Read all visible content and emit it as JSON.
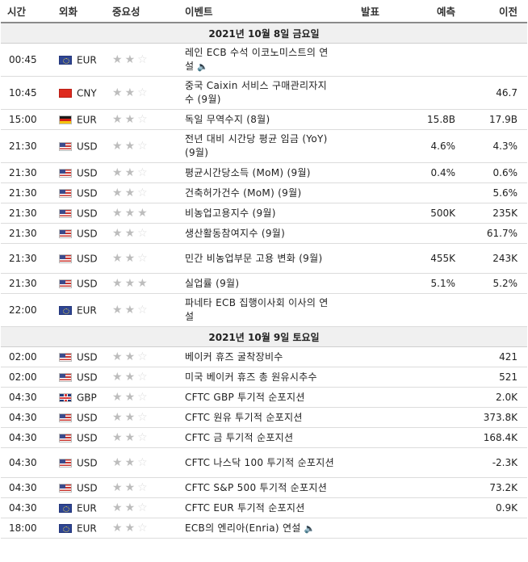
{
  "header": {
    "time": "시간",
    "currency": "외화",
    "importance": "중요성",
    "event": "이벤트",
    "actual": "발표",
    "forecast": "예측",
    "previous": "이전"
  },
  "days": [
    {
      "date": "2021년 10월 8일 금요일",
      "rows": [
        {
          "time": "00:45",
          "flag": "f-eu",
          "currency": "EUR",
          "stars": 2,
          "event": "레인 ECB 수석 이코노미스트의 연설",
          "speaker": true,
          "actual": "",
          "forecast": "",
          "previous": ""
        },
        {
          "time": "10:45",
          "flag": "f-cn",
          "currency": "CNY",
          "stars": 2,
          "event": "중국 Caixin 서비스 구매관리자지수 (9월)",
          "speaker": false,
          "actual": "",
          "forecast": "",
          "previous": "46.7"
        },
        {
          "time": "15:00",
          "flag": "f-de",
          "currency": "EUR",
          "stars": 2,
          "event": "독일 무역수지 (8월)",
          "speaker": false,
          "actual": "",
          "forecast": "15.8B",
          "previous": "17.9B"
        },
        {
          "time": "21:30",
          "flag": "f-us",
          "currency": "USD",
          "stars": 2,
          "event": "전년 대비 시간당 평균 임금 (YoY) (9월)",
          "speaker": false,
          "actual": "",
          "forecast": "4.6%",
          "previous": "4.3%"
        },
        {
          "time": "21:30",
          "flag": "f-us",
          "currency": "USD",
          "stars": 2,
          "event": "평균시간당소득 (MoM) (9월)",
          "speaker": false,
          "actual": "",
          "forecast": "0.4%",
          "previous": "0.6%"
        },
        {
          "time": "21:30",
          "flag": "f-us",
          "currency": "USD",
          "stars": 2,
          "event": "건축허가건수 (MoM) (9월)",
          "speaker": false,
          "actual": "",
          "forecast": "",
          "previous": "5.6%"
        },
        {
          "time": "21:30",
          "flag": "f-us",
          "currency": "USD",
          "stars": 3,
          "event": "비농업고용지수 (9월)",
          "speaker": false,
          "actual": "",
          "forecast": "500K",
          "previous": "235K"
        },
        {
          "time": "21:30",
          "flag": "f-us",
          "currency": "USD",
          "stars": 2,
          "event": "생산활동참여지수 (9월)",
          "speaker": false,
          "actual": "",
          "forecast": "",
          "previous": "61.7%"
        },
        {
          "time": "21:30",
          "flag": "f-us",
          "currency": "USD",
          "stars": 2,
          "event": "민간 비농업부문 고용 변화 (9월)",
          "speaker": false,
          "actual": "",
          "forecast": "455K",
          "previous": "243K"
        },
        {
          "time": "21:30",
          "flag": "f-us",
          "currency": "USD",
          "stars": 3,
          "event": "실업률 (9월)",
          "speaker": false,
          "actual": "",
          "forecast": "5.1%",
          "previous": "5.2%"
        },
        {
          "time": "22:00",
          "flag": "f-eu",
          "currency": "EUR",
          "stars": 2,
          "event": "파네타 ECB 집행이사회 이사의 연설",
          "speaker": false,
          "actual": "",
          "forecast": "",
          "previous": ""
        }
      ]
    },
    {
      "date": "2021년 10월 9일 토요일",
      "rows": [
        {
          "time": "02:00",
          "flag": "f-us",
          "currency": "USD",
          "stars": 2,
          "event": "베이커 휴즈 굴착장비수",
          "speaker": false,
          "actual": "",
          "forecast": "",
          "previous": "421"
        },
        {
          "time": "02:00",
          "flag": "f-us",
          "currency": "USD",
          "stars": 2,
          "event": "미국 베이커 휴즈 총 원유시추수",
          "speaker": false,
          "actual": "",
          "forecast": "",
          "previous": "521"
        },
        {
          "time": "04:30",
          "flag": "f-gb",
          "currency": "GBP",
          "stars": 2,
          "event": "CFTC GBP 투기적 순포지션",
          "speaker": false,
          "actual": "",
          "forecast": "",
          "previous": "2.0K"
        },
        {
          "time": "04:30",
          "flag": "f-us",
          "currency": "USD",
          "stars": 2,
          "event": "CFTC 원유 투기적 순포지션",
          "speaker": false,
          "actual": "",
          "forecast": "",
          "previous": "373.8K"
        },
        {
          "time": "04:30",
          "flag": "f-us",
          "currency": "USD",
          "stars": 2,
          "event": "CFTC 금 투기적 순포지션",
          "speaker": false,
          "actual": "",
          "forecast": "",
          "previous": "168.4K"
        },
        {
          "time": "04:30",
          "flag": "f-us",
          "currency": "USD",
          "stars": 2,
          "event": "CFTC 나스닥 100 투기적 순포지션",
          "speaker": false,
          "actual": "",
          "forecast": "",
          "previous": "-2.3K"
        },
        {
          "time": "04:30",
          "flag": "f-us",
          "currency": "USD",
          "stars": 2,
          "event": "CFTC S&P 500 투기적 순포지션",
          "speaker": false,
          "actual": "",
          "forecast": "",
          "previous": "73.2K"
        },
        {
          "time": "04:30",
          "flag": "f-eu",
          "currency": "EUR",
          "stars": 2,
          "event": "CFTC EUR 투기적 순포지션",
          "speaker": false,
          "actual": "",
          "forecast": "",
          "previous": "0.9K"
        },
        {
          "time": "18:00",
          "flag": "f-eu",
          "currency": "EUR",
          "stars": 2,
          "event": "ECB의 엔리아(Enria) 연설",
          "speaker": true,
          "actual": "",
          "forecast": "",
          "previous": ""
        }
      ]
    }
  ]
}
